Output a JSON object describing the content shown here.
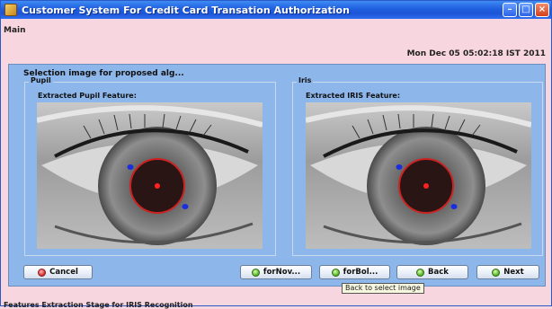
{
  "window": {
    "title": "Customer System For Credit Card Transation Authorization",
    "controls": {
      "minimize": "–",
      "maximize": "□",
      "close": "×"
    }
  },
  "menu": {
    "main": "Main"
  },
  "datetime": "Mon Dec 05 05:02:18 IST 2011",
  "selection_label": "Selection image for proposed alg...",
  "pupil_panel": {
    "title": "Pupil",
    "subtitle": "Extracted Pupil Feature:"
  },
  "iris_panel": {
    "title": "Iris",
    "subtitle": "Extracted IRIS Feature:"
  },
  "buttons": {
    "cancel": {
      "label": "Cancel",
      "icon": "cancel-icon"
    },
    "fornov": {
      "label": "forNov...",
      "icon": "go-icon"
    },
    "forbol": {
      "label": "forBol...",
      "icon": "go-icon"
    },
    "back": {
      "label": "Back",
      "icon": "go-icon"
    },
    "next": {
      "label": "Next",
      "icon": "go-icon"
    }
  },
  "tooltip": "Back to select image",
  "status": "Features Extraction Stage for IRIS Recognition",
  "colors": {
    "window_bg": "#f7d6df",
    "panel_bg": "#8db6ea",
    "titlebar": "#1f5fe0",
    "pupil_circle": "#cc2222",
    "marker_blue": "#1a2ee0"
  }
}
